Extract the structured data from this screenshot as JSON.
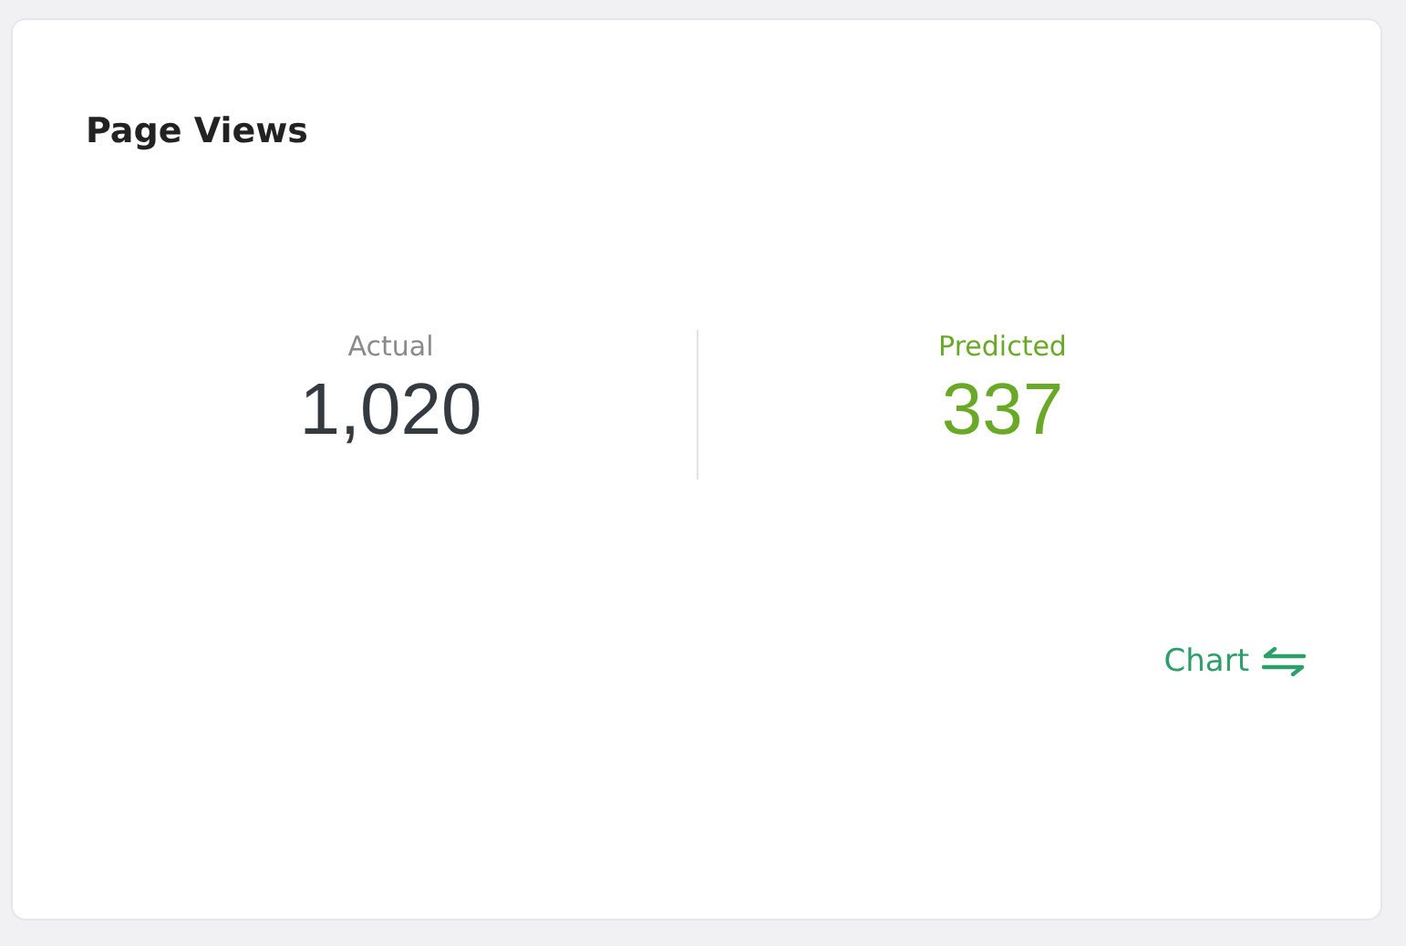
{
  "card": {
    "title": "Page Views",
    "metrics": [
      {
        "label": "Actual",
        "value": "1,020",
        "color": "#343a40"
      },
      {
        "label": "Predicted",
        "value": "337",
        "color": "#6aa827"
      }
    ],
    "toggle_link": {
      "label": "Chart"
    }
  }
}
